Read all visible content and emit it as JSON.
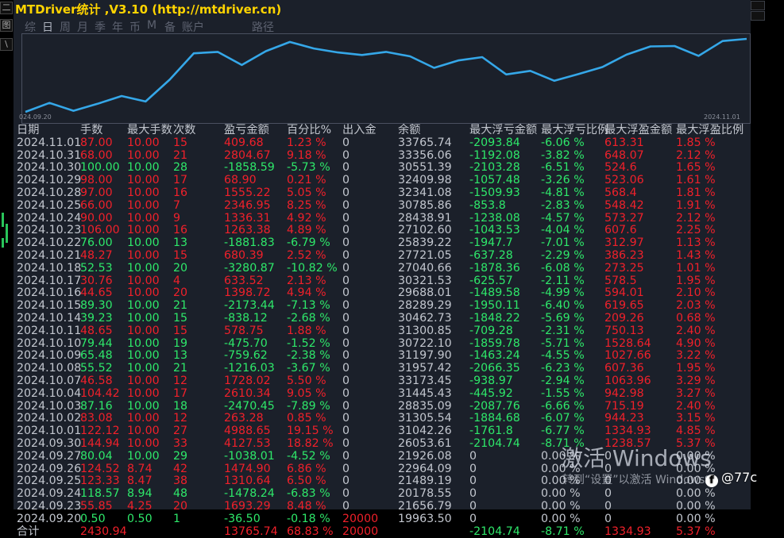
{
  "window": {
    "title": "MTDriver统计 ,V3.10 (http://mtdriver.cn)"
  },
  "left_strip": {
    "glyphs": [
      "二",
      "图",
      "\\"
    ]
  },
  "tabs": [
    {
      "label": "综",
      "active": false
    },
    {
      "label": "日",
      "active": true
    },
    {
      "label": "周",
      "active": false
    },
    {
      "label": "月",
      "active": false
    },
    {
      "label": "季",
      "active": false
    },
    {
      "label": "年",
      "active": false
    },
    {
      "label": "币",
      "active": false
    },
    {
      "label": "M",
      "active": false
    },
    {
      "label": "备",
      "active": false
    },
    {
      "label": "账户",
      "active": false
    },
    {
      "label": "路径",
      "active": false
    }
  ],
  "chart_data": {
    "type": "line",
    "x_start_label": "024.09.20",
    "x_end_label": "2024.11.01",
    "series": [
      {
        "values": [
          19963.5,
          21656.79,
          20178.55,
          21489.19,
          22964.09,
          21926.08,
          26053.61,
          31042.26,
          31305.54,
          28835.09,
          31445.43,
          33173.45,
          31957.42,
          31197.9,
          30722.1,
          31300.85,
          30462.73,
          28289.29,
          29688.01,
          30321.53,
          27040.66,
          27721.05,
          25839.22,
          27102.6,
          28438.91,
          30785.86,
          32341.08,
          32409.98,
          30551.39,
          33356.06,
          33765.74
        ]
      }
    ],
    "color": "#35a7e8"
  },
  "table": {
    "headers": [
      "日期",
      "手数",
      "最大手数",
      "次数",
      "盈亏金额",
      "百分比%",
      "出入金",
      "余额",
      "最大浮亏金额",
      "最大浮亏比例",
      "最大浮盈金额",
      "最大浮盈比例"
    ],
    "rows": [
      {
        "date": "2024.11.01",
        "lots": "87.00",
        "max_lots": "10.00",
        "count": "15",
        "pnl": "409.68",
        "pct": "1.23 %",
        "flow": "0",
        "balance": "33765.74",
        "max_loss": "-2093.84",
        "max_loss_pct": "-6.06 %",
        "max_gain": "613.31",
        "max_gain_pct": "1.85 %",
        "c": [
          "r",
          "r",
          "r",
          "r",
          "r",
          "w",
          "w",
          "g",
          "g",
          "r",
          "r"
        ]
      },
      {
        "date": "2024.10.31",
        "lots": "68.00",
        "max_lots": "10.00",
        "count": "21",
        "pnl": "2804.67",
        "pct": "9.18 %",
        "flow": "0",
        "balance": "33356.06",
        "max_loss": "-1192.08",
        "max_loss_pct": "-3.82 %",
        "max_gain": "648.07",
        "max_gain_pct": "2.12 %",
        "c": [
          "r",
          "r",
          "r",
          "r",
          "r",
          "w",
          "w",
          "g",
          "g",
          "r",
          "r"
        ]
      },
      {
        "date": "2024.10.30",
        "lots": "100.00",
        "max_lots": "10.00",
        "count": "28",
        "pnl": "-1858.59",
        "pct": "-5.73 %",
        "flow": "0",
        "balance": "30551.39",
        "max_loss": "-2103.28",
        "max_loss_pct": "-6.51 %",
        "max_gain": "524.6",
        "max_gain_pct": "1.65 %",
        "c": [
          "g",
          "g",
          "g",
          "g",
          "g",
          "w",
          "w",
          "g",
          "g",
          "r",
          "r"
        ]
      },
      {
        "date": "2024.10.29",
        "lots": "98.00",
        "max_lots": "10.00",
        "count": "17",
        "pnl": "68.90",
        "pct": "0.21 %",
        "flow": "0",
        "balance": "32409.98",
        "max_loss": "-1057.48",
        "max_loss_pct": "-3.26 %",
        "max_gain": "523.06",
        "max_gain_pct": "1.61 %",
        "c": [
          "r",
          "r",
          "r",
          "r",
          "r",
          "w",
          "w",
          "g",
          "g",
          "r",
          "r"
        ]
      },
      {
        "date": "2024.10.28",
        "lots": "97.00",
        "max_lots": "10.00",
        "count": "16",
        "pnl": "1555.22",
        "pct": "5.05 %",
        "flow": "0",
        "balance": "32341.08",
        "max_loss": "-1509.93",
        "max_loss_pct": "-4.81 %",
        "max_gain": "568.4",
        "max_gain_pct": "1.81 %",
        "c": [
          "r",
          "r",
          "r",
          "r",
          "r",
          "w",
          "w",
          "g",
          "g",
          "r",
          "r"
        ]
      },
      {
        "date": "2024.10.25",
        "lots": "66.00",
        "max_lots": "10.00",
        "count": "7",
        "pnl": "2346.95",
        "pct": "8.25 %",
        "flow": "0",
        "balance": "30785.86",
        "max_loss": "-853.8",
        "max_loss_pct": "-2.83 %",
        "max_gain": "548.42",
        "max_gain_pct": "1.91 %",
        "c": [
          "r",
          "r",
          "r",
          "r",
          "r",
          "w",
          "w",
          "g",
          "g",
          "r",
          "r"
        ]
      },
      {
        "date": "2024.10.24",
        "lots": "90.00",
        "max_lots": "10.00",
        "count": "9",
        "pnl": "1336.31",
        "pct": "4.92 %",
        "flow": "0",
        "balance": "28438.91",
        "max_loss": "-1238.08",
        "max_loss_pct": "-4.57 %",
        "max_gain": "573.27",
        "max_gain_pct": "2.12 %",
        "c": [
          "r",
          "r",
          "r",
          "r",
          "r",
          "w",
          "w",
          "g",
          "g",
          "r",
          "r"
        ]
      },
      {
        "date": "2024.10.23",
        "lots": "106.00",
        "max_lots": "10.00",
        "count": "16",
        "pnl": "1263.38",
        "pct": "4.89 %",
        "flow": "0",
        "balance": "27102.60",
        "max_loss": "-1043.53",
        "max_loss_pct": "-4.04 %",
        "max_gain": "607.6",
        "max_gain_pct": "2.25 %",
        "c": [
          "r",
          "r",
          "r",
          "r",
          "r",
          "w",
          "w",
          "g",
          "g",
          "r",
          "r"
        ]
      },
      {
        "date": "2024.10.22",
        "lots": "76.00",
        "max_lots": "10.00",
        "count": "13",
        "pnl": "-1881.83",
        "pct": "-6.79 %",
        "flow": "0",
        "balance": "25839.22",
        "max_loss": "-1947.7",
        "max_loss_pct": "-7.01 %",
        "max_gain": "312.97",
        "max_gain_pct": "1.13 %",
        "c": [
          "g",
          "g",
          "g",
          "g",
          "g",
          "w",
          "w",
          "g",
          "g",
          "r",
          "r"
        ]
      },
      {
        "date": "2024.10.21",
        "lots": "48.27",
        "max_lots": "10.00",
        "count": "15",
        "pnl": "680.39",
        "pct": "2.52 %",
        "flow": "0",
        "balance": "27721.05",
        "max_loss": "-637.28",
        "max_loss_pct": "-2.29 %",
        "max_gain": "386.23",
        "max_gain_pct": "1.43 %",
        "c": [
          "r",
          "r",
          "r",
          "r",
          "r",
          "w",
          "w",
          "g",
          "g",
          "r",
          "r"
        ]
      },
      {
        "date": "2024.10.18",
        "lots": "52.53",
        "max_lots": "10.00",
        "count": "20",
        "pnl": "-3280.87",
        "pct": "-10.82 %",
        "flow": "0",
        "balance": "27040.66",
        "max_loss": "-1878.36",
        "max_loss_pct": "-6.08 %",
        "max_gain": "273.25",
        "max_gain_pct": "1.01 %",
        "c": [
          "g",
          "g",
          "g",
          "g",
          "g",
          "w",
          "w",
          "g",
          "g",
          "r",
          "r"
        ]
      },
      {
        "date": "2024.10.17",
        "lots": "30.76",
        "max_lots": "10.00",
        "count": "4",
        "pnl": "633.52",
        "pct": "2.13 %",
        "flow": "0",
        "balance": "30321.53",
        "max_loss": "-625.57",
        "max_loss_pct": "-2.11 %",
        "max_gain": "578.5",
        "max_gain_pct": "1.95 %",
        "c": [
          "r",
          "r",
          "r",
          "r",
          "r",
          "w",
          "w",
          "g",
          "g",
          "r",
          "r"
        ]
      },
      {
        "date": "2024.10.16",
        "lots": "44.65",
        "max_lots": "10.00",
        "count": "20",
        "pnl": "1398.72",
        "pct": "4.94 %",
        "flow": "0",
        "balance": "29688.01",
        "max_loss": "-1489.58",
        "max_loss_pct": "-4.99 %",
        "max_gain": "594.01",
        "max_gain_pct": "2.10 %",
        "c": [
          "r",
          "r",
          "r",
          "r",
          "r",
          "w",
          "w",
          "g",
          "g",
          "r",
          "r"
        ]
      },
      {
        "date": "2024.10.15",
        "lots": "89.30",
        "max_lots": "10.00",
        "count": "21",
        "pnl": "-2173.44",
        "pct": "-7.13 %",
        "flow": "0",
        "balance": "28289.29",
        "max_loss": "-1950.11",
        "max_loss_pct": "-6.40 %",
        "max_gain": "619.65",
        "max_gain_pct": "2.03 %",
        "c": [
          "g",
          "g",
          "g",
          "g",
          "g",
          "w",
          "w",
          "g",
          "g",
          "r",
          "r"
        ]
      },
      {
        "date": "2024.10.14",
        "lots": "39.23",
        "max_lots": "10.00",
        "count": "15",
        "pnl": "-838.12",
        "pct": "-2.68 %",
        "flow": "0",
        "balance": "30462.73",
        "max_loss": "-1848.22",
        "max_loss_pct": "-5.69 %",
        "max_gain": "209.26",
        "max_gain_pct": "0.68 %",
        "c": [
          "g",
          "g",
          "g",
          "g",
          "g",
          "w",
          "w",
          "g",
          "g",
          "r",
          "r"
        ]
      },
      {
        "date": "2024.10.11",
        "lots": "48.65",
        "max_lots": "10.00",
        "count": "15",
        "pnl": "578.75",
        "pct": "1.88 %",
        "flow": "0",
        "balance": "31300.85",
        "max_loss": "-709.28",
        "max_loss_pct": "-2.31 %",
        "max_gain": "750.13",
        "max_gain_pct": "2.40 %",
        "c": [
          "r",
          "r",
          "r",
          "r",
          "r",
          "w",
          "w",
          "g",
          "g",
          "r",
          "r"
        ]
      },
      {
        "date": "2024.10.10",
        "lots": "79.44",
        "max_lots": "10.00",
        "count": "19",
        "pnl": "-475.70",
        "pct": "-1.52 %",
        "flow": "0",
        "balance": "30722.10",
        "max_loss": "-1859.78",
        "max_loss_pct": "-5.71 %",
        "max_gain": "1528.64",
        "max_gain_pct": "4.90 %",
        "c": [
          "g",
          "g",
          "g",
          "g",
          "g",
          "w",
          "w",
          "g",
          "g",
          "r",
          "r"
        ]
      },
      {
        "date": "2024.10.09",
        "lots": "65.48",
        "max_lots": "10.00",
        "count": "13",
        "pnl": "-759.62",
        "pct": "-2.38 %",
        "flow": "0",
        "balance": "31197.90",
        "max_loss": "-1463.24",
        "max_loss_pct": "-4.55 %",
        "max_gain": "1027.66",
        "max_gain_pct": "3.22 %",
        "c": [
          "g",
          "g",
          "g",
          "g",
          "g",
          "w",
          "w",
          "g",
          "g",
          "r",
          "r"
        ]
      },
      {
        "date": "2024.10.08",
        "lots": "55.52",
        "max_lots": "10.00",
        "count": "21",
        "pnl": "-1216.03",
        "pct": "-3.67 %",
        "flow": "0",
        "balance": "31957.42",
        "max_loss": "-2066.35",
        "max_loss_pct": "-6.23 %",
        "max_gain": "607.36",
        "max_gain_pct": "1.95 %",
        "c": [
          "g",
          "g",
          "g",
          "g",
          "g",
          "w",
          "w",
          "g",
          "g",
          "r",
          "r"
        ]
      },
      {
        "date": "2024.10.07",
        "lots": "46.58",
        "max_lots": "10.00",
        "count": "12",
        "pnl": "1728.02",
        "pct": "5.50 %",
        "flow": "0",
        "balance": "33173.45",
        "max_loss": "-938.97",
        "max_loss_pct": "-2.94 %",
        "max_gain": "1063.96",
        "max_gain_pct": "3.29 %",
        "c": [
          "r",
          "r",
          "r",
          "r",
          "r",
          "w",
          "w",
          "g",
          "g",
          "r",
          "r"
        ]
      },
      {
        "date": "2024.10.04",
        "lots": "104.42",
        "max_lots": "10.00",
        "count": "17",
        "pnl": "2610.34",
        "pct": "9.05 %",
        "flow": "0",
        "balance": "31445.43",
        "max_loss": "-445.92",
        "max_loss_pct": "-1.55 %",
        "max_gain": "942.98",
        "max_gain_pct": "3.27 %",
        "c": [
          "r",
          "r",
          "r",
          "r",
          "r",
          "w",
          "w",
          "g",
          "g",
          "r",
          "r"
        ]
      },
      {
        "date": "2024.10.03",
        "lots": "87.16",
        "max_lots": "10.00",
        "count": "18",
        "pnl": "-2470.45",
        "pct": "-7.89 %",
        "flow": "0",
        "balance": "28835.09",
        "max_loss": "-2087.76",
        "max_loss_pct": "-6.66 %",
        "max_gain": "715.19",
        "max_gain_pct": "2.40 %",
        "c": [
          "g",
          "g",
          "g",
          "g",
          "g",
          "w",
          "w",
          "g",
          "g",
          "r",
          "r"
        ]
      },
      {
        "date": "2024.10.02",
        "lots": "83.08",
        "max_lots": "10.00",
        "count": "12",
        "pnl": "263.28",
        "pct": "0.85 %",
        "flow": "0",
        "balance": "31305.54",
        "max_loss": "-1884.68",
        "max_loss_pct": "-6.07 %",
        "max_gain": "944.23",
        "max_gain_pct": "3.15 %",
        "c": [
          "r",
          "r",
          "r",
          "r",
          "r",
          "w",
          "w",
          "g",
          "g",
          "r",
          "r"
        ]
      },
      {
        "date": "2024.10.01",
        "lots": "122.12",
        "max_lots": "10.00",
        "count": "27",
        "pnl": "4988.65",
        "pct": "19.15 %",
        "flow": "0",
        "balance": "31042.26",
        "max_loss": "-1761.8",
        "max_loss_pct": "-6.77 %",
        "max_gain": "1334.93",
        "max_gain_pct": "4.85 %",
        "c": [
          "r",
          "r",
          "r",
          "r",
          "r",
          "w",
          "w",
          "g",
          "g",
          "r",
          "r"
        ]
      },
      {
        "date": "2024.09.30",
        "lots": "144.94",
        "max_lots": "10.00",
        "count": "33",
        "pnl": "4127.53",
        "pct": "18.82 %",
        "flow": "0",
        "balance": "26053.61",
        "max_loss": "-2104.74",
        "max_loss_pct": "-8.71 %",
        "max_gain": "1238.57",
        "max_gain_pct": "5.37 %",
        "c": [
          "r",
          "r",
          "r",
          "r",
          "r",
          "w",
          "w",
          "g",
          "g",
          "r",
          "r"
        ]
      },
      {
        "date": "2024.09.27",
        "lots": "80.04",
        "max_lots": "10.00",
        "count": "29",
        "pnl": "-1038.01",
        "pct": "-4.52 %",
        "flow": "0",
        "balance": "21926.08",
        "max_loss": "0",
        "max_loss_pct": "0.00 %",
        "max_gain": "0",
        "max_gain_pct": "0.00 %",
        "c": [
          "g",
          "g",
          "g",
          "g",
          "g",
          "w",
          "w",
          "w",
          "w",
          "w",
          "w"
        ]
      },
      {
        "date": "2024.09.26",
        "lots": "124.52",
        "max_lots": "8.74",
        "count": "42",
        "pnl": "1474.90",
        "pct": "6.86 %",
        "flow": "0",
        "balance": "22964.09",
        "max_loss": "0",
        "max_loss_pct": "0.00 %",
        "max_gain": "0",
        "max_gain_pct": "0.00 %",
        "c": [
          "r",
          "r",
          "r",
          "r",
          "r",
          "w",
          "w",
          "w",
          "w",
          "w",
          "w"
        ]
      },
      {
        "date": "2024.09.25",
        "lots": "123.33",
        "max_lots": "8.47",
        "count": "38",
        "pnl": "1310.64",
        "pct": "6.50 %",
        "flow": "0",
        "balance": "21489.19",
        "max_loss": "0",
        "max_loss_pct": "0.00 %",
        "max_gain": "0",
        "max_gain_pct": "0.00 %",
        "c": [
          "r",
          "r",
          "r",
          "r",
          "r",
          "w",
          "w",
          "w",
          "w",
          "w",
          "w"
        ]
      },
      {
        "date": "2024.09.24",
        "lots": "118.57",
        "max_lots": "8.94",
        "count": "48",
        "pnl": "-1478.24",
        "pct": "-6.83 %",
        "flow": "0",
        "balance": "20178.55",
        "max_loss": "0",
        "max_loss_pct": "0.00 %",
        "max_gain": "0",
        "max_gain_pct": "0.00 %",
        "c": [
          "g",
          "g",
          "g",
          "g",
          "g",
          "w",
          "w",
          "w",
          "w",
          "w",
          "w"
        ]
      },
      {
        "date": "2024.09.23",
        "lots": "55.85",
        "max_lots": "4.25",
        "count": "20",
        "pnl": "1693.29",
        "pct": "8.48 %",
        "flow": "0",
        "balance": "21656.79",
        "max_loss": "0",
        "max_loss_pct": "0.00 %",
        "max_gain": "0",
        "max_gain_pct": "0.00 %",
        "c": [
          "r",
          "r",
          "r",
          "r",
          "r",
          "w",
          "w",
          "w",
          "w",
          "w",
          "w"
        ]
      },
      {
        "date": "2024.09.20",
        "lots": "0.50",
        "max_lots": "0.50",
        "count": "1",
        "pnl": "-36.50",
        "pct": "-0.18 %",
        "flow": "20000",
        "balance": "19963.50",
        "max_loss": "0",
        "max_loss_pct": "0.00 %",
        "max_gain": "0",
        "max_gain_pct": "0.00 %",
        "c": [
          "g",
          "g",
          "g",
          "g",
          "g",
          "r",
          "w",
          "w",
          "w",
          "w",
          "w"
        ]
      }
    ],
    "total": {
      "label": "合计",
      "lots": "2430.94",
      "pnl": "13765.74",
      "pct": "68.83 %",
      "flow": "20000",
      "max_loss": "-2104.74",
      "max_loss_pct": "-8.71 %",
      "max_gain": "1334.93",
      "max_gain_pct": "5.37 %"
    }
  },
  "watermark": {
    "line1": "激活 Windows",
    "line2": "转到“设置”以激活 Windows。"
  },
  "badge": {
    "text": "@77c"
  },
  "colors": {
    "profit": "#f0202a",
    "loss": "#2ee86a",
    "neutral": "#c3c7cf",
    "title": "#ffd400",
    "line": "#35a7e8",
    "panel_bg": "#1b202a"
  }
}
